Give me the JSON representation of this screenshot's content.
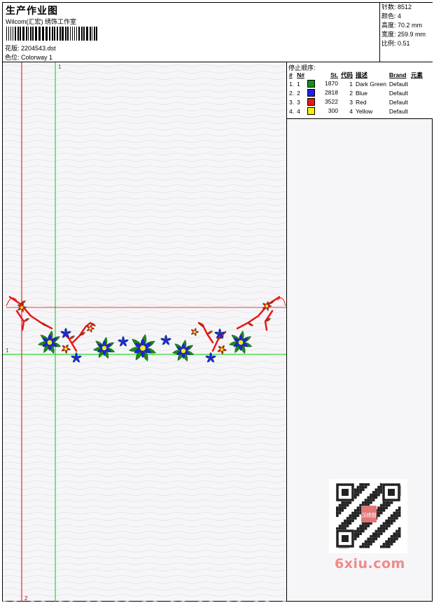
{
  "header": {
    "title": "生产作业图",
    "subtitle": "Wilcom(汇宏) 绣饰工作室",
    "design_label": "花版:",
    "design_value": "2204543.dst",
    "colorway_label": "色位:",
    "colorway_value": "Colorway 1"
  },
  "stats": {
    "stitches": "针数: 8512",
    "colors": "颜色: 4",
    "height": "高度: 70.2 mm",
    "width": "宽度: 259.9 mm",
    "scale": "比例: 0.51"
  },
  "stop_sequence": {
    "title": "停止顺序:",
    "headers": [
      "#",
      "N#",
      "St.",
      "代码",
      "描述",
      "Brand",
      "元素"
    ],
    "rows": [
      {
        "index": "1.",
        "needle": "1",
        "color": "#1b8c1b",
        "stitches": "1870",
        "code": "1",
        "desc": "Dark Green",
        "brand": "Default"
      },
      {
        "index": "2.",
        "needle": "2",
        "color": "#1f22e0",
        "stitches": "2818",
        "code": "2",
        "desc": "Blue",
        "brand": "Default"
      },
      {
        "index": "3.",
        "needle": "3",
        "color": "#e81818",
        "stitches": "3522",
        "code": "3",
        "desc": "Red",
        "brand": "Default"
      },
      {
        "index": "4.",
        "needle": "4",
        "color": "#f2ee10",
        "stitches": "300",
        "code": "4",
        "desc": "Yellow",
        "brand": "Default"
      }
    ]
  },
  "guides": {
    "top_label": "1",
    "left_label": "1",
    "bottom_label": "2"
  },
  "watermark": {
    "text": "6xiu.com",
    "qr_caption": "汉绣图"
  },
  "colors": {
    "vertical_guide_red": "#e00000",
    "vertical_guide_green": "#00d000",
    "green": "#1b8c1b",
    "blue": "#1f22e0",
    "red": "#e81818",
    "yellow": "#f2ee10"
  }
}
